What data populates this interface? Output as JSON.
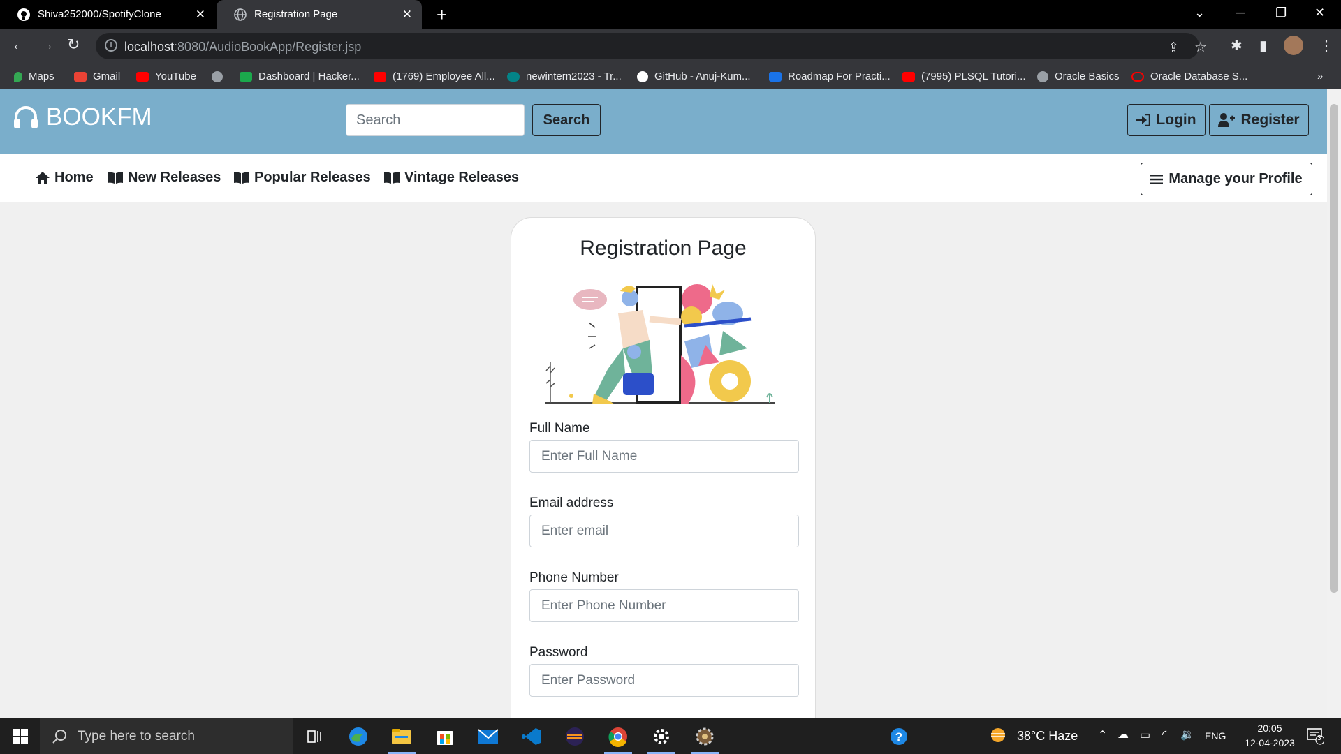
{
  "browser": {
    "tabs": [
      {
        "title": "Shiva252000/SpotifyClone",
        "icon": "github-icon",
        "active": false
      },
      {
        "title": "Registration Page",
        "icon": "globe-icon",
        "active": true
      }
    ],
    "url_host": "localhost",
    "url_rest": ":8080/AudioBookApp/Register.jsp",
    "bookmarks": [
      {
        "label": "Maps",
        "icon": "maps-icon",
        "color": "#34a853"
      },
      {
        "label": "Gmail",
        "icon": "gmail-icon",
        "color": "#ea4335"
      },
      {
        "label": "YouTube",
        "icon": "youtube-icon",
        "color": "#ff0000"
      },
      {
        "label": "",
        "icon": "globe-icon",
        "color": "#9aa0a6"
      },
      {
        "label": "Dashboard | Hacker...",
        "icon": "hackerrank-icon",
        "color": "#1ba94c"
      },
      {
        "label": "(1769) Employee All...",
        "icon": "youtube-icon",
        "color": "#ff0000"
      },
      {
        "label": "newintern2023 - Tr...",
        "icon": "sharepoint-icon",
        "color": "#038387"
      },
      {
        "label": "GitHub - Anuj-Kum...",
        "icon": "github-icon",
        "color": "#ffffff"
      },
      {
        "label": "Roadmap For Practi...",
        "icon": "link-icon",
        "color": "#1a73e8"
      },
      {
        "label": "(7995) PLSQL Tutori...",
        "icon": "youtube-icon",
        "color": "#ff0000"
      },
      {
        "label": "Oracle Basics",
        "icon": "globe-icon",
        "color": "#9aa0a6"
      },
      {
        "label": "Oracle Database S...",
        "icon": "oracle-icon",
        "color": "#f80000"
      }
    ],
    "more_bookmarks": "»"
  },
  "site": {
    "brand": "BOOKFM",
    "search_placeholder": "Search",
    "search_button": "Search",
    "login": "Login",
    "register": "Register",
    "nav": [
      "Home",
      "New Releases",
      "Popular Releases",
      "Vintage Releases"
    ],
    "manage_profile": "Manage your Profile"
  },
  "form": {
    "title": "Registration Page",
    "fields": [
      {
        "label": "Full Name",
        "placeholder": "Enter Full Name"
      },
      {
        "label": "Email address",
        "placeholder": "Enter email"
      },
      {
        "label": "Phone Number",
        "placeholder": "Enter Phone Number"
      },
      {
        "label": "Password",
        "placeholder": "Enter Password"
      }
    ]
  },
  "taskbar": {
    "search_placeholder": "Type here to search",
    "weather": "38°C Haze",
    "language": "ENG",
    "time": "20:05",
    "date": "12-04-2023",
    "notification_count": "3"
  },
  "colors": {
    "header": "#7aaecb",
    "page_bg": "#f0f0f0",
    "chrome_dark": "#35363a"
  }
}
